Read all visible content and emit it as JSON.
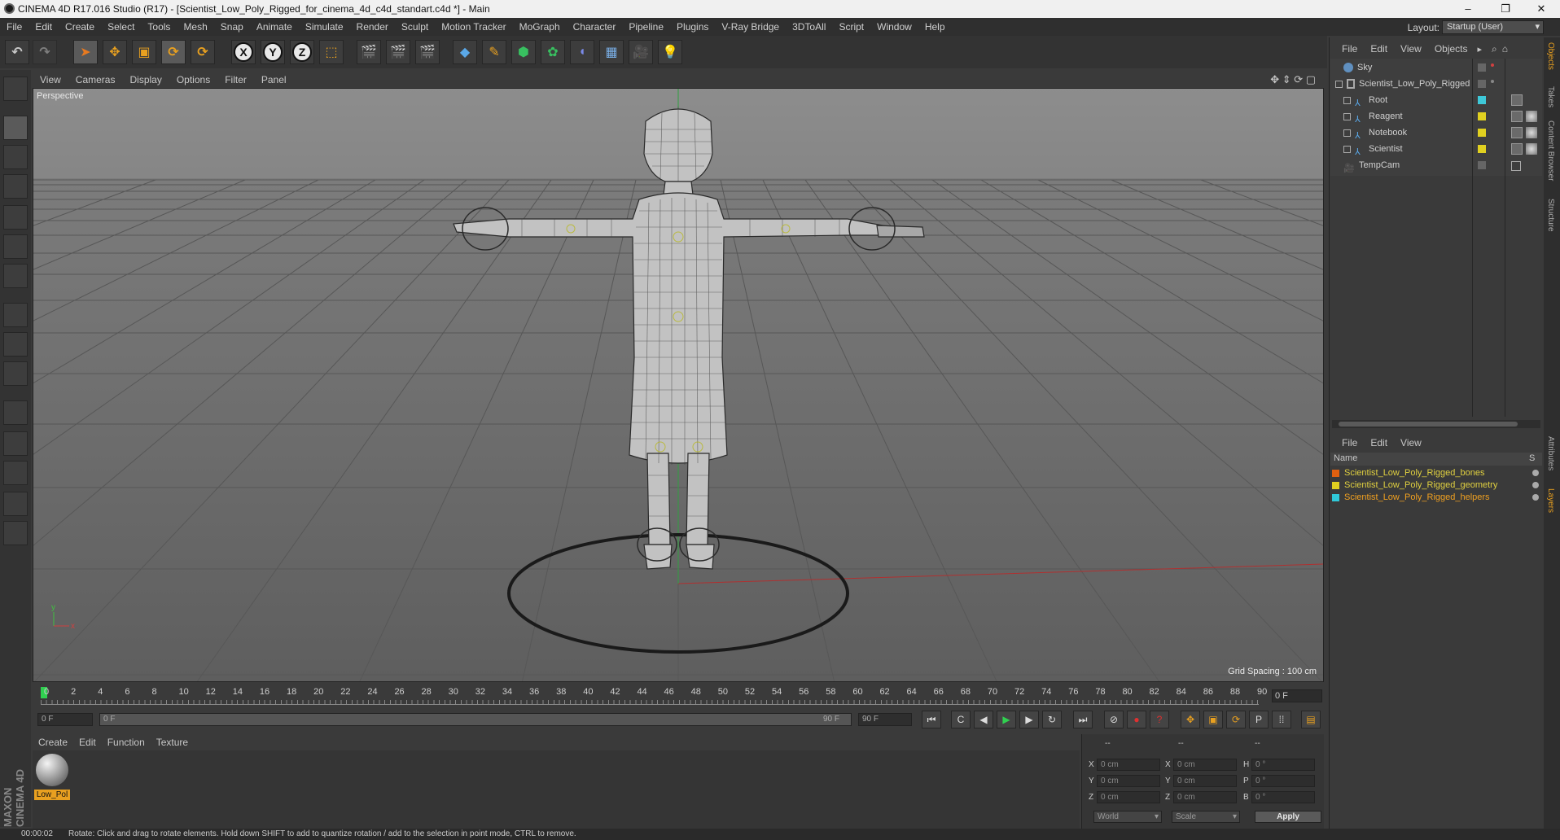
{
  "window": {
    "title": "CINEMA 4D R17.016 Studio (R17) - [Scientist_Low_Poly_Rigged_for_cinema_4d_c4d_standart.c4d *] - Main",
    "controls": [
      "–",
      "❐",
      "✕"
    ]
  },
  "menu": [
    "File",
    "Edit",
    "Create",
    "Select",
    "Tools",
    "Mesh",
    "Snap",
    "Animate",
    "Simulate",
    "Render",
    "Sculpt",
    "Motion Tracker",
    "MoGraph",
    "Character",
    "Pipeline",
    "Plugins",
    "V-Ray Bridge",
    "3DToAll",
    "Script",
    "Window",
    "Help"
  ],
  "layout": {
    "label": "Layout:",
    "value": "Startup (User)"
  },
  "toolbar": {
    "axis_x": "X",
    "axis_y": "Y",
    "axis_z": "Z"
  },
  "viewport": {
    "menu": [
      "View",
      "Cameras",
      "Display",
      "Options",
      "Filter",
      "Panel"
    ],
    "label": "Perspective",
    "grid_spacing": "Grid Spacing : 100 cm",
    "axis_y": "y",
    "axis_x": "x"
  },
  "timeline": {
    "ticks": [
      "0",
      "2",
      "4",
      "6",
      "8",
      "10",
      "12",
      "14",
      "16",
      "18",
      "20",
      "22",
      "24",
      "26",
      "28",
      "30",
      "32",
      "34",
      "36",
      "38",
      "40",
      "42",
      "44",
      "46",
      "48",
      "50",
      "52",
      "54",
      "56",
      "58",
      "60",
      "62",
      "64",
      "66",
      "68",
      "70",
      "72",
      "74",
      "76",
      "78",
      "80",
      "82",
      "84",
      "86",
      "88",
      "90"
    ],
    "current_frame": "0 F",
    "start": "0 F",
    "range_start": "0 F",
    "range_end": "90 F",
    "end": "90 F"
  },
  "materials": {
    "menu": [
      "Create",
      "Edit",
      "Function",
      "Texture"
    ],
    "items": [
      {
        "label": "Low_Pol"
      }
    ]
  },
  "coords": {
    "header": [
      "--",
      "--",
      "--"
    ],
    "rows": [
      {
        "a": "X",
        "av": "0 cm",
        "b": "X",
        "bv": "0 cm",
        "c": "H",
        "cv": "0 °"
      },
      {
        "a": "Y",
        "av": "0 cm",
        "b": "Y",
        "bv": "0 cm",
        "c": "P",
        "cv": "0 °"
      },
      {
        "a": "Z",
        "av": "0 cm",
        "b": "Z",
        "bv": "0 cm",
        "c": "B",
        "cv": "0 °"
      }
    ],
    "world": "World",
    "scale": "Scale",
    "apply": "Apply"
  },
  "status": {
    "time": "00:00:02",
    "message": "Rotate: Click and drag to rotate elements. Hold down SHIFT to add to quantize rotation / add to the selection in point mode, CTRL to remove."
  },
  "objects": {
    "menu": [
      "File",
      "Edit",
      "View",
      "Objects"
    ],
    "items": [
      {
        "name": "Sky",
        "indent": 0
      },
      {
        "name": "Scientist_Low_Poly_Rigged",
        "indent": 0
      },
      {
        "name": "Root",
        "indent": 1,
        "color": "#3ec8d8"
      },
      {
        "name": "Reagent",
        "indent": 1,
        "color": "#e0d020"
      },
      {
        "name": "Notebook",
        "indent": 1,
        "color": "#e0d020"
      },
      {
        "name": "Scientist",
        "indent": 1,
        "color": "#e0d020"
      },
      {
        "name": "TempCam",
        "indent": 0
      }
    ]
  },
  "layers": {
    "menu": [
      "File",
      "Edit",
      "View"
    ],
    "header_name": "Name",
    "header_s": "S",
    "items": [
      {
        "name": "Scientist_Low_Poly_Rigged_bones",
        "color": "#e06010"
      },
      {
        "name": "Scientist_Low_Poly_Rigged_geometry",
        "color": "#e0d020"
      },
      {
        "name": "Scientist_Low_Poly_Rigged_helpers",
        "color": "#30c8d8",
        "highlight": "#f0a020"
      }
    ]
  },
  "side_tabs": [
    "Objects",
    "Takes",
    "Content Browser",
    "Structure",
    "Attributes",
    "Layers"
  ],
  "brand": "MAXON CINEMA 4D"
}
